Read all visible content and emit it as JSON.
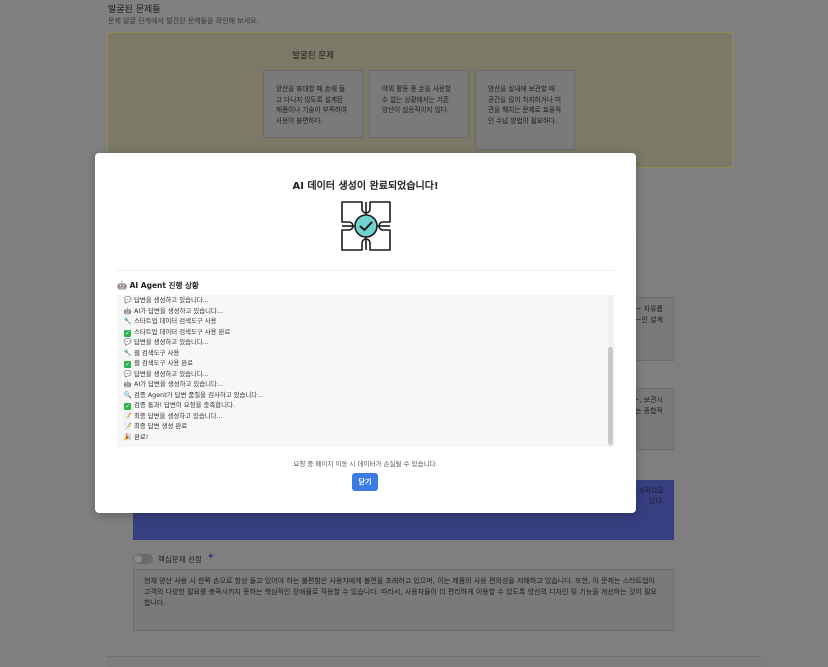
{
  "background": {
    "section_title": "발굴된 문제들",
    "section_subtitle": "문제 발굴 단계에서 발견된 문제들을 확인해 보세요.",
    "problems_title": "발굴된 문제",
    "cards": [
      "양산을 휴대할 때 손에 들고 다니지 않도록 설계된 제품이나 기술이 부족하여 사용이 불편하다.",
      "야외 활동 중 손을 사용할 수 없는 상황에서는 기존 양산이 실용적이지 않다.",
      "양산을 실내에 보관할 때 공간을 많이 차지하거나 미관을 해치는 문제로 효율적인 수납 방법이 필요하다."
    ],
    "textarea1_visible": "~ 자유롭\n~인 설계",
    "textarea2_visible": "~, 보관시\n~는 종합적",
    "blue_block_visible": "과적으로\n있다.",
    "core_toggle_label": "핵심문제 선정",
    "core_problem_text": "현재 양산 사용 시 한쪽 손으로 항상 들고 있어야 하는 불편함은 사용자에게 불편을 초래하고 있으며, 이는 제품의 사용 편의성을 저해하고 있습니다. 또한, 이 문제는 스타트업이 고객의 다양한 필요를 충족시키지 못하는 핵심적인 장애물로 작용할 수 있습니다. 따라서, 사용자들이 더 편리하게 이용할 수 있도록 양산의 디자인 및 기능을 개선하는 것이 필요합니다."
  },
  "modal": {
    "title": "AI 데이터 생성이 완료되었습니다!",
    "icon": "puzzle-check-icon",
    "agent_header": "AI Agent 진행 상황",
    "log": [
      {
        "icon": "speech",
        "text": "답변을 생성하고 있습니다..."
      },
      {
        "icon": "robot",
        "text": "AI가 답변을 생성하고 있습니다..."
      },
      {
        "icon": "wrench",
        "text": "스타트업 데이터 검색도구 사용"
      },
      {
        "icon": "check",
        "text": "스타트업 데이터 검색도구 사용 완료"
      },
      {
        "icon": "speech",
        "text": "답변을 생성하고 있습니다..."
      },
      {
        "icon": "wrench",
        "text": "웹 검색도구 사용"
      },
      {
        "icon": "check",
        "text": "웹 검색도구 사용 완료"
      },
      {
        "icon": "speech",
        "text": "답변을 생성하고 있습니다..."
      },
      {
        "icon": "robot",
        "text": "AI가 답변을 생성하고 있습니다..."
      },
      {
        "icon": "magnifier",
        "text": "검증 Agent가 답변 품질을 검사하고 있습니다..."
      },
      {
        "icon": "check",
        "text": "검증 통과! 답변이 요청을 충족합니다."
      },
      {
        "icon": "memo",
        "text": "최종 답변을 생성하고 있습니다..."
      },
      {
        "icon": "memo",
        "text": "최종 답변 생성 완료"
      },
      {
        "icon": "party",
        "text": "완료!"
      }
    ],
    "warning": "요청 중 페이지 이동 시 데이터가 손실될 수 있습니다.",
    "close_label": "닫기"
  },
  "colors": {
    "accent": "#3b7ce3",
    "success": "#2fb24a",
    "icon_teal": "#6fd3cf"
  }
}
